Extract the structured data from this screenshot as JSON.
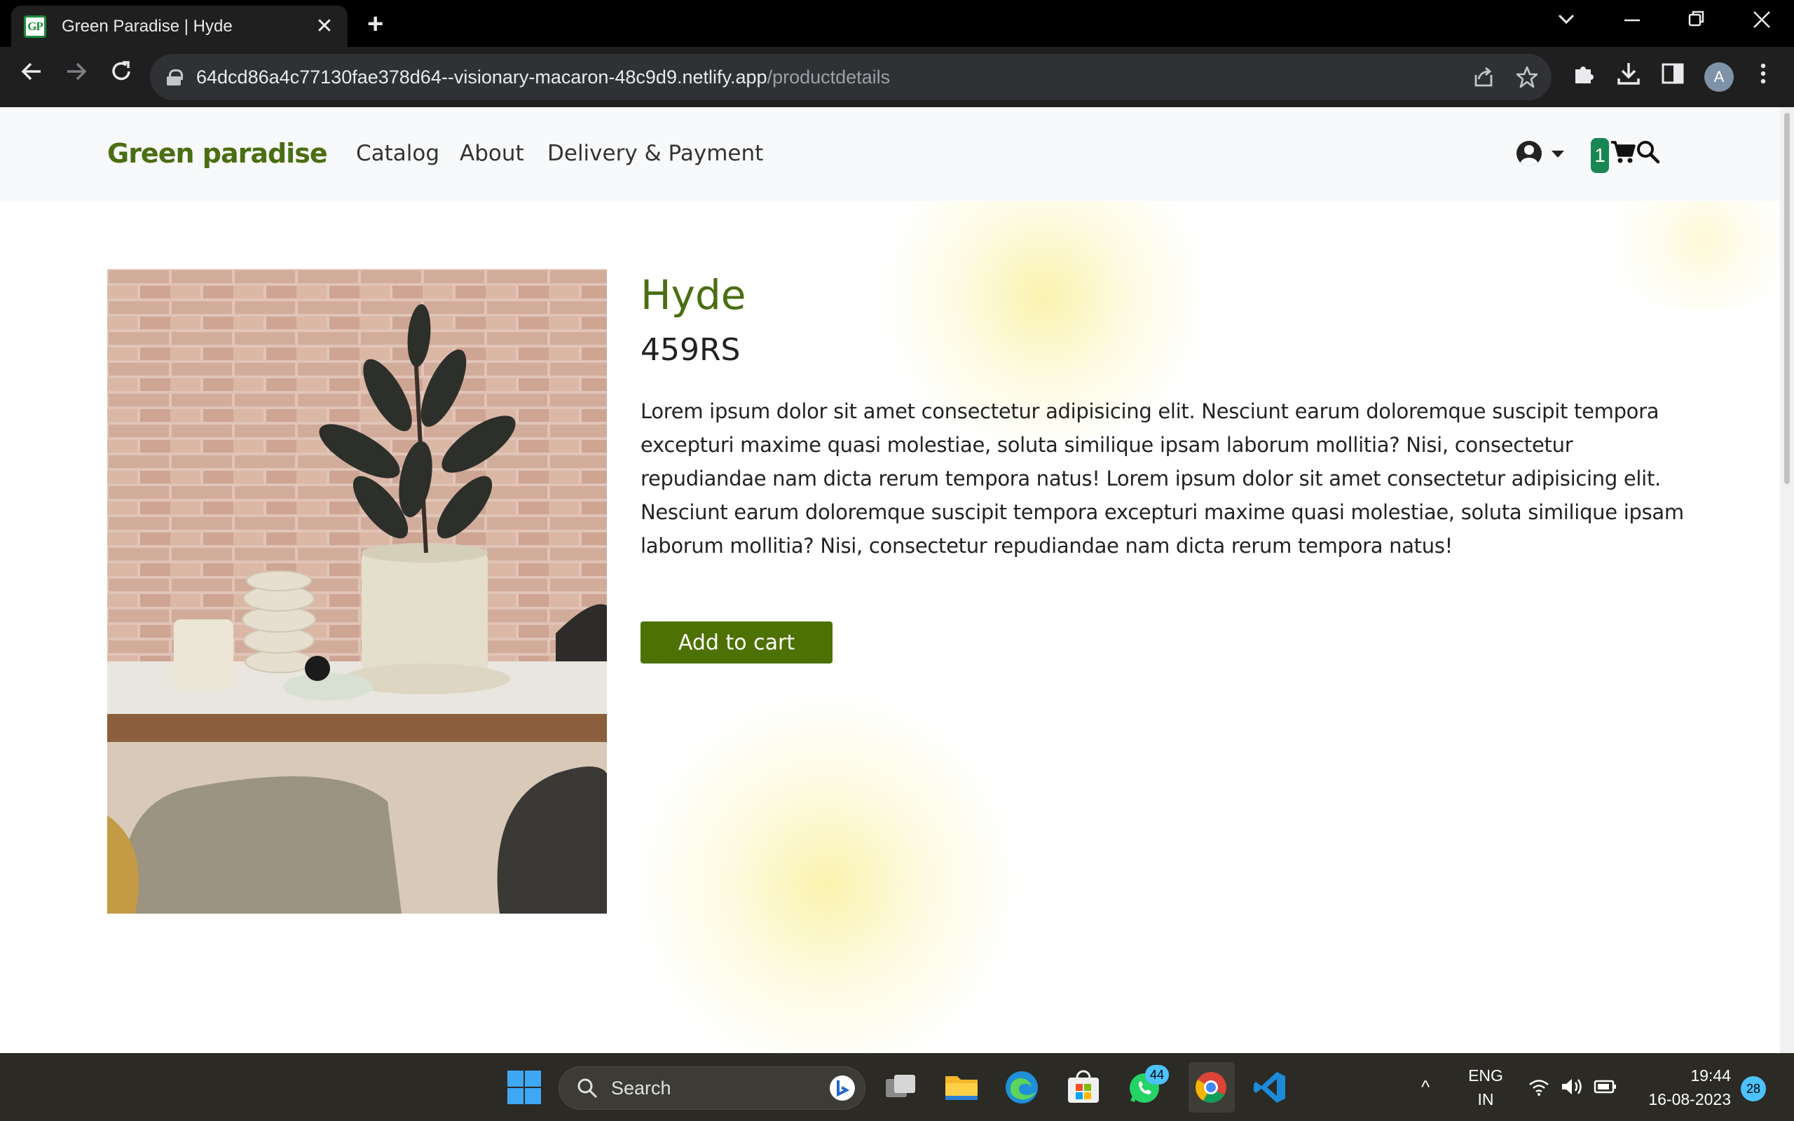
{
  "browser": {
    "tab_title": "Green Paradise | Hyde",
    "favicon_text": "GP",
    "url_host": "64dcd86a4c77130fae378d64--visionary-macaron-48c9d9.netlify.app",
    "url_path": "/productdetails",
    "profile_initial": "A"
  },
  "site": {
    "brand": "Green paradise",
    "nav": [
      "Catalog",
      "About",
      "Delivery & Payment"
    ],
    "cart_count": "1"
  },
  "product": {
    "title": "Hyde",
    "price": "459RS",
    "description": "Lorem ipsum dolor sit amet consectetur adipisicing elit. Nesciunt earum doloremque suscipit tempora excepturi maxime quasi molestiae, soluta similique ipsam laborum mollitia? Nisi, consectetur repudiandae nam dicta rerum tempora natus! Lorem ipsum dolor sit amet consectetur adipisicing elit. Nesciunt earum doloremque suscipit tempora excepturi maxime quasi molestiae, soluta similique ipsam laborum mollitia? Nisi, consectetur repudiandae nam dicta rerum tempora natus!",
    "add_button": "Add to cart"
  },
  "taskbar": {
    "search_label": "Search",
    "whatsapp_badge": "44",
    "language": "ENG",
    "region": "IN",
    "time": "19:44",
    "date": "16-08-2023",
    "notification_count": "28"
  },
  "colors": {
    "brand_green": "#4a6e12",
    "button_green": "#4d7103",
    "badge_green": "#198754"
  }
}
